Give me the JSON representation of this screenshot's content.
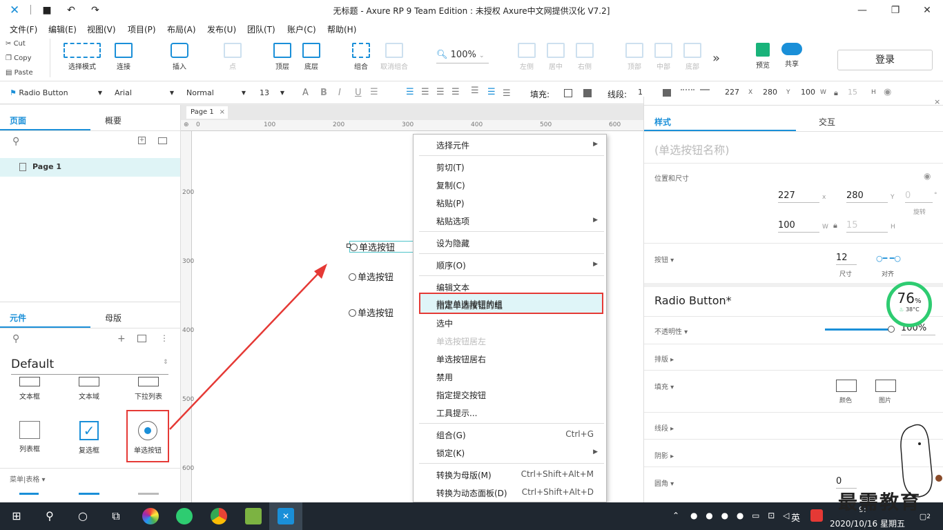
{
  "window": {
    "title": "无标题 - Axure RP 9 Team Edition : 未授权    Axure中文网提供汉化 V7.2]"
  },
  "menu": [
    "文件(F)",
    "编辑(E)",
    "视图(V)",
    "项目(P)",
    "布局(A)",
    "发布(U)",
    "团队(T)",
    "账户(C)",
    "帮助(H)"
  ],
  "clipboard": {
    "cut": "Cut",
    "copy": "Copy",
    "paste": "Paste"
  },
  "toolbar": {
    "select_mode": "选择模式",
    "connect": "连接",
    "insert": "插入",
    "point": "点",
    "top": "顶层",
    "bottom": "底层",
    "group": "组合",
    "ungroup": "取消组合",
    "zoom": "100%",
    "align_left": "左侧",
    "align_center": "居中",
    "align_right": "右侧",
    "align_top": "顶部",
    "align_middle": "中部",
    "align_bottom": "底部",
    "more": "»",
    "preview": "预览",
    "share": "共享",
    "login": "登录"
  },
  "format": {
    "widget_type": "Radio Button",
    "font": "Arial",
    "style": "Normal",
    "size": "13",
    "fill_label": "填充:",
    "stroke_label": "线段:",
    "stroke_value": "1",
    "x": "227",
    "x_lbl": "X",
    "y": "280",
    "y_lbl": "Y",
    "w": "100",
    "w_lbl": "W",
    "h": "15",
    "h_lbl": "H"
  },
  "left": {
    "tab_pages": "页面",
    "tab_outline": "概要",
    "page_item": "Page 1",
    "tab_widgets": "元件",
    "tab_masters": "母版",
    "library": "Default",
    "widgets": [
      {
        "label": "文本框"
      },
      {
        "label": "文本域"
      },
      {
        "label": "下拉列表"
      },
      {
        "label": "列表框"
      },
      {
        "label": "复选框"
      },
      {
        "label": "单选按钮"
      }
    ],
    "category": "菜单|表格 ▾"
  },
  "canvas": {
    "page_tab": "Page 1",
    "ruler_h": [
      "0",
      "100",
      "200",
      "300",
      "400",
      "500",
      "600"
    ],
    "ruler_v": [
      "200",
      "300",
      "400",
      "500",
      "600"
    ],
    "radios": [
      "单选按钮",
      "单选按钮",
      "单选按钮"
    ]
  },
  "context_menu": [
    {
      "label": "选择元件",
      "arrow": "▶"
    },
    {
      "label": "剪切(T)"
    },
    {
      "label": "复制(C)"
    },
    {
      "label": "粘贴(P)"
    },
    {
      "label": "粘贴选项",
      "arrow": "▶"
    },
    {
      "label": "设为隐藏"
    },
    {
      "label": "顺序(O)",
      "arrow": "▶"
    },
    {
      "label": "编辑文本"
    },
    {
      "label": "指定单选按钮的组"
    },
    {
      "label": "选中"
    },
    {
      "label": "单选按钮居左"
    },
    {
      "label": "单选按钮居右"
    },
    {
      "label": "禁用"
    },
    {
      "label": "指定提交按钮"
    },
    {
      "label": "工具提示..."
    },
    {
      "label": "组合(G)",
      "shortcut": "Ctrl+G"
    },
    {
      "label": "锁定(K)",
      "arrow": "▶"
    },
    {
      "label": "转换为母版(M)",
      "shortcut": "Ctrl+Shift+Alt+M"
    },
    {
      "label": "转换为动态面板(D)",
      "shortcut": "Ctrl+Shift+Alt+D"
    }
  ],
  "right": {
    "tab_style": "样式",
    "tab_interact": "交互",
    "name_placeholder": "(单选按钮名称)",
    "pos_size": "位置和尺寸",
    "x": "227",
    "x_lbl": "x",
    "y": "280",
    "y_lbl": "Y",
    "rot": "0",
    "rot_unit": "°",
    "rot_lbl": "旋转",
    "w": "100",
    "w_lbl": "W",
    "h": "15",
    "h_lbl": "H",
    "button": "按钮 ▾",
    "btn_size": "12",
    "btn_size_lbl": "尺寸",
    "align_lbl": "对齐",
    "widget_name": "Radio Button*",
    "opacity": "不透明性 ▾",
    "opacity_val": "100%",
    "layout": "排版 ▸",
    "fill": "填充 ▾",
    "fill_color": "颜色",
    "fill_image": "图片",
    "stroke": "线段 ▸",
    "shadow": "阴影 ▸",
    "corner": "圆角 ▾",
    "corner_val": "0"
  },
  "gauge": {
    "value": "76",
    "unit": "%",
    "temp": "38°C"
  },
  "taskbar": {
    "ime": "英",
    "time": "9:",
    "date": "2020/10/16 星期五",
    "badge": "2"
  },
  "watermark": "最需教育",
  "colors": {
    "accent": "#1a8fd8",
    "highlight": "#e53935"
  }
}
